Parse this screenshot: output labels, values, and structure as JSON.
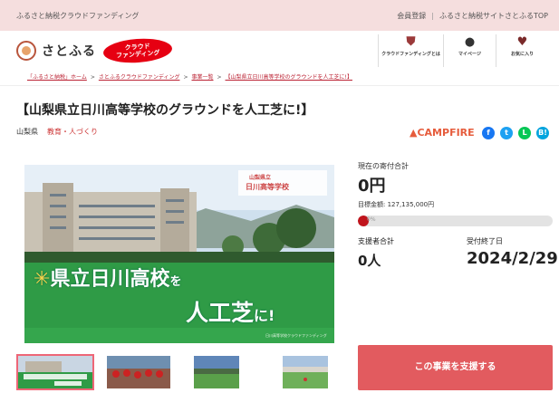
{
  "topbar": {
    "brand": "ふるさと納税クラウドファンディング",
    "links": [
      "会員登録",
      "ふるさと納税サイトさとふるTOP"
    ]
  },
  "logo": {
    "text": "さとふる",
    "badge_line1": "クラウド",
    "badge_line2": "ファンディング"
  },
  "nav": [
    {
      "label": "クラウドファンディングとは",
      "icon": "shield-icon"
    },
    {
      "label": "マイページ",
      "icon": "person-icon"
    },
    {
      "label": "お気に入り",
      "icon": "heart-icon"
    }
  ],
  "breadcrumb": [
    "「ふるさと納税」ホーム",
    "さとふるクラウドファンディング",
    "事業一覧",
    "【山梨県立日川高等学校のグラウンドを人工芝に!】"
  ],
  "project": {
    "title": "【山梨県立日川高等学校のグラウンドを人工芝に!】",
    "prefecture": "山梨県",
    "category": "教育・人づくり",
    "partner": "CAMPFIRE"
  },
  "share": [
    "f",
    "t",
    "L",
    "B!"
  ],
  "hero": {
    "school_tag": "山梨県立",
    "school_name": "日川高等学校",
    "headline1": "県立日川高校",
    "headline1_suffix": "を",
    "headline2": "人工芝",
    "headline2_suffix": "に!",
    "footer": "日川高等学校クラウドファンディング"
  },
  "stats": {
    "total_label": "現在の寄付合計",
    "total_value": "0円",
    "goal": "目標金額: 127,135,000円",
    "progress_text": "0%",
    "progress_fraction": 0,
    "supporters_label": "支援者合計",
    "supporters_value": "0人",
    "deadline_label": "受付終了日",
    "deadline_value": "2024/2/29"
  },
  "support_button": "この事業を支援する",
  "colors": {
    "topbar": "#f5dede",
    "accent": "#c0141c",
    "button": "#e25b5f",
    "campfire": "#e65c3c"
  }
}
